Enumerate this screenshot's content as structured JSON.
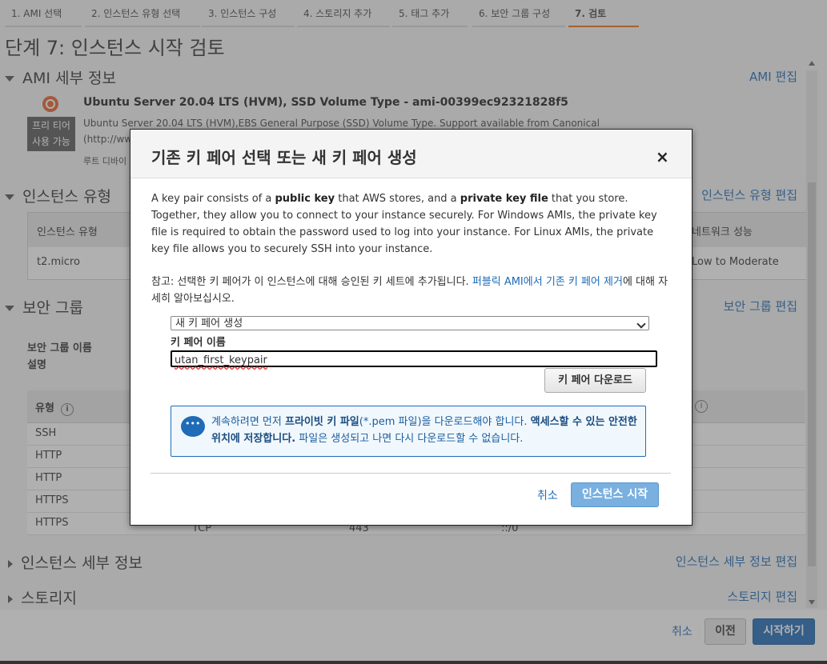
{
  "tabs": [
    "1. AMI 선택",
    "2. 인스턴스 유형 선택",
    "3. 인스턴스 구성",
    "4. 스토리지 추가",
    "5. 태그 추가",
    "6. 보안 그룹 구성",
    "7. 검토"
  ],
  "page_title": "단계 7: 인스턴스 시작 검토",
  "ami": {
    "section_title": "AMI 세부 정보",
    "edit": "AMI 편집",
    "name": "Ubuntu Server 20.04 LTS (HVM), SSD Volume Type - ami-00399ec92321828f5",
    "free_tier_line1": "프리 티어",
    "free_tier_line2": "사용 가능",
    "description": "Ubuntu Server 20.04 LTS (HVM),EBS General Purpose (SSD) Volume Type. Support available from Canonical",
    "description2": "(http://www",
    "root_device": "루트 디바이"
  },
  "instance_type": {
    "section_title": "인스턴스 유형",
    "edit": "인스턴스 유형 편집",
    "col_type": "인스턴스 유형",
    "col_network": "네트워크 성능",
    "value_type": "t2.micro",
    "value_network": "Low to Moderate"
  },
  "security_group": {
    "section_title": "보안 그룹",
    "edit": "보안 그룹 편집",
    "name_label": "보안 그룹 이름",
    "desc_label": "설명",
    "col_type": "유형",
    "rows": [
      "SSH",
      "HTTP",
      "HTTP",
      "HTTPS",
      "HTTPS"
    ],
    "row5_protocol": "TCP",
    "row5_port": "443",
    "row5_source": "::/0"
  },
  "instance_details": {
    "section_title": "인스턴스 세부 정보",
    "edit": "인스턴스 세부 정보 편집"
  },
  "storage": {
    "section_title": "스토리지",
    "edit": "스토리지 편집"
  },
  "footer": {
    "cancel": "취소",
    "previous": "이전",
    "launch": "시작하기"
  },
  "modal": {
    "title": "기존 키 페어 선택 또는 새 키 페어 생성",
    "close": "×",
    "intro_1": "A key pair consists of a ",
    "intro_b1": "public key",
    "intro_2": " that AWS stores, and a ",
    "intro_b2": "private key file",
    "intro_3": " that you store. Together, they allow you to connect to your instance securely. For Windows AMIs, the private key file is required to obtain the password used to log into your instance. For Linux AMIs, the private key file allows you to securely SSH into your instance.",
    "note_1": "참고: 선택한 키 페어가 이 인스턴스에 대해 승인된 키 세트에 추가됩니다. ",
    "note_link": "퍼블릭 AMI에서 기존 키 페어 제거",
    "note_2": "에 대해 자세히 알아보십시오.",
    "select_value": "새 키 페어 생성",
    "keypair_label": "키 페어 이름",
    "keypair_value": "utan_first_keypair",
    "download_button": "키 페어 다운로드",
    "alert_1": "계속하려면 먼저 ",
    "alert_b1": "프라이빗 키 파일",
    "alert_2": "(*.pem 파일)을 다운로드해야 합니다. ",
    "alert_b2": "액세스할 수 있는 안전한 위치에 저장합니다.",
    "alert_3": " 파일은 생성되고 나면 다시 다운로드할 수 없습니다.",
    "cancel": "취소",
    "launch": "인스턴스 시작"
  }
}
